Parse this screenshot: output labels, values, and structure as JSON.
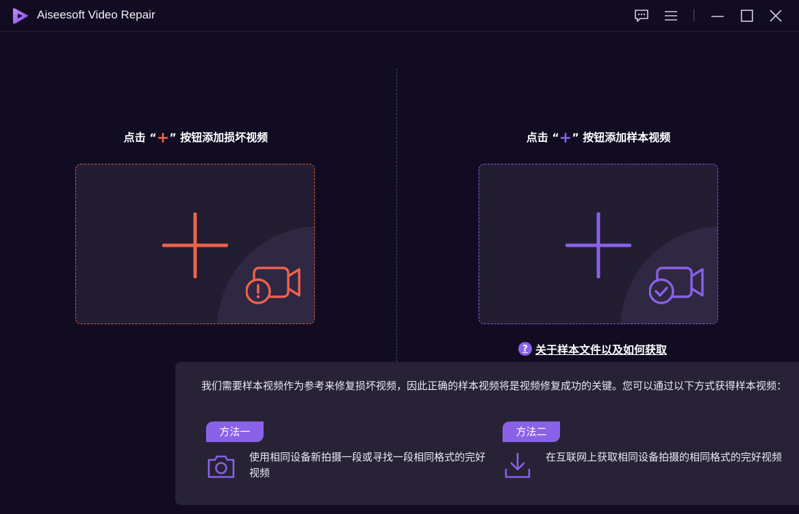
{
  "app": {
    "title": "Aiseesoft Video Repair"
  },
  "colors": {
    "background": "#120c22",
    "broken_accent": "#f0624d",
    "sample_accent": "#8a62e8",
    "panel": "#272236"
  },
  "window_controls": [
    "feedback-icon",
    "menu-icon",
    "minimize-icon",
    "maximize-icon",
    "close-icon"
  ],
  "left_panel": {
    "heading_before": "点击 “",
    "heading_plus": "+",
    "heading_after": "” 按钮添加损坏视频",
    "icon": "camera-warning-icon"
  },
  "right_panel": {
    "heading_before": "点击 “",
    "heading_plus": "+",
    "heading_after": "” 按钮添加样本视频",
    "icon": "camera-check-icon",
    "help_icon": "?",
    "help_link": "关于样本文件以及如何获取"
  },
  "info": {
    "text": "我们需要样本视频作为参考来修复损坏视频，因此正确的样本视频将是视频修复成功的关键。您可以通过以下方式获得样本视频：",
    "methods": [
      {
        "tag": "方法一",
        "icon": "camera-icon",
        "text": "使用相同设备新拍摄一段或寻找一段相同格式的完好视频"
      },
      {
        "tag": "方法二",
        "icon": "download-icon",
        "text": "在互联网上获取相同设备拍摄的相同格式的完好视频"
      }
    ]
  }
}
